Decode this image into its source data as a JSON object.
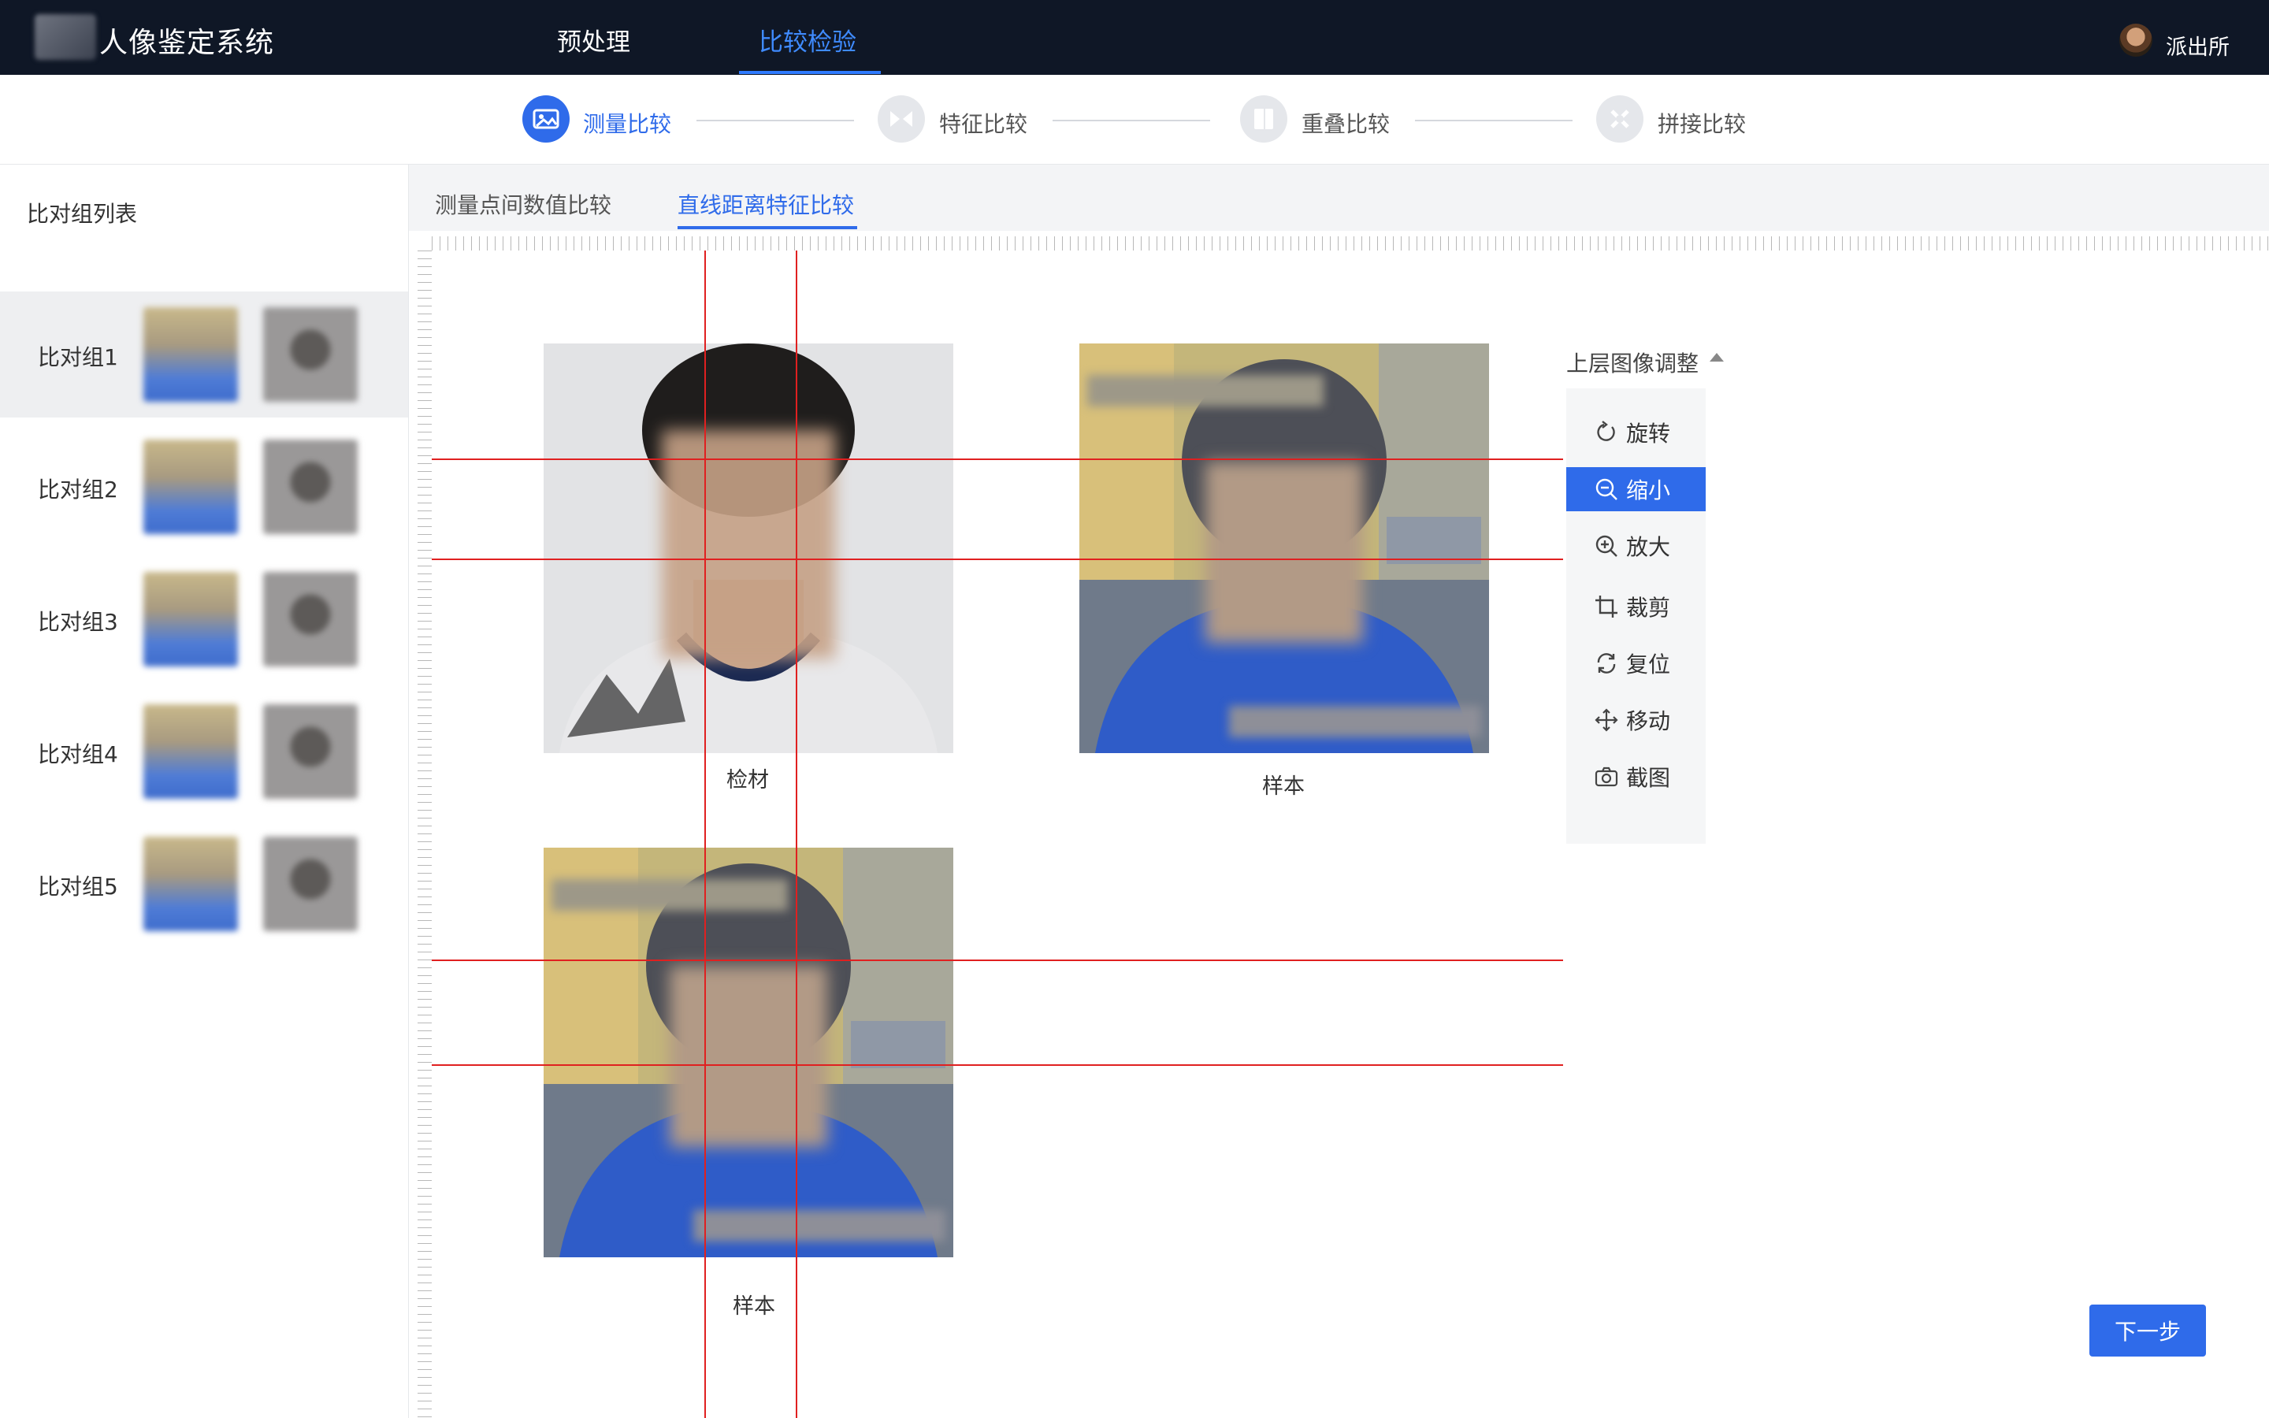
{
  "app": {
    "title": "人像鉴定系统"
  },
  "nav": {
    "items": [
      "预处理",
      "比较检验"
    ],
    "active_index": 1
  },
  "user": {
    "name": "派出所"
  },
  "steps": [
    {
      "label": "测量比较",
      "active": true,
      "icon": "image-measure-icon"
    },
    {
      "label": "特征比较",
      "active": false,
      "icon": "feature-compare-icon"
    },
    {
      "label": "重叠比较",
      "active": false,
      "icon": "overlay-compare-icon"
    },
    {
      "label": "拼接比较",
      "active": false,
      "icon": "stitch-compare-icon"
    }
  ],
  "sidebar": {
    "title": "比对组列表",
    "groups": [
      {
        "label": "比对组1",
        "selected": true
      },
      {
        "label": "比对组2",
        "selected": false
      },
      {
        "label": "比对组3",
        "selected": false
      },
      {
        "label": "比对组4",
        "selected": false
      },
      {
        "label": "比对组5",
        "selected": false
      }
    ]
  },
  "subtabs": {
    "items": [
      "测量点间数值比较",
      "直线距离特征比较"
    ],
    "active_index": 1
  },
  "images": {
    "captions": [
      "检材",
      "样本",
      "样本"
    ]
  },
  "tools": {
    "title": "上层图像调整",
    "items": [
      {
        "label": "旋转",
        "icon": "rotate-icon",
        "selected": false
      },
      {
        "label": "缩小",
        "icon": "zoom-out-icon",
        "selected": true
      },
      {
        "label": "放大",
        "icon": "zoom-in-icon",
        "selected": false
      },
      {
        "label": "裁剪",
        "icon": "crop-icon",
        "selected": false
      },
      {
        "label": "复位",
        "icon": "reset-icon",
        "selected": false
      },
      {
        "label": "移动",
        "icon": "move-icon",
        "selected": false
      },
      {
        "label": "截图",
        "icon": "camera-icon",
        "selected": false
      }
    ]
  },
  "actions": {
    "next_label": "下一步"
  },
  "colors": {
    "accent": "#2f6bea",
    "topbar": "#0f1726",
    "guide_line": "#e02020"
  }
}
